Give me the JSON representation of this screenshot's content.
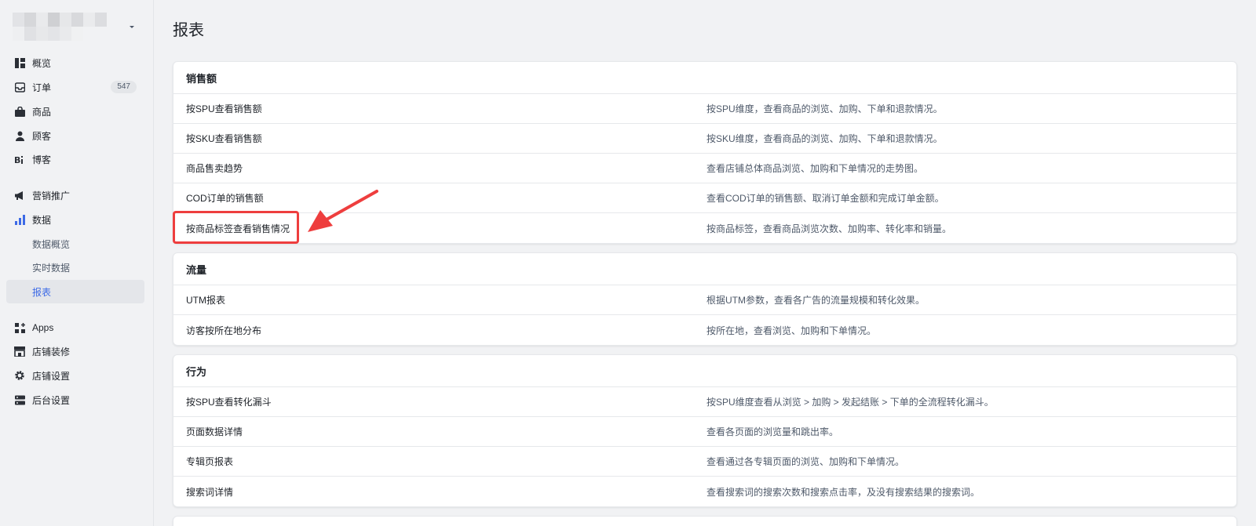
{
  "sidebar": {
    "nav": [
      {
        "label": "概览",
        "icon": "dashboard-icon"
      },
      {
        "label": "订单",
        "icon": "inbox-icon",
        "badge": "547"
      },
      {
        "label": "商品",
        "icon": "bag-icon"
      },
      {
        "label": "顾客",
        "icon": "person-icon"
      },
      {
        "label": "博客",
        "icon": "blog-icon"
      },
      {
        "label": "营销推广",
        "icon": "megaphone-icon"
      },
      {
        "label": "数据",
        "icon": "bar-chart-icon"
      }
    ],
    "data_sub": [
      "数据概览",
      "实时数据",
      "报表"
    ],
    "nav2": [
      {
        "label": "Apps",
        "icon": "apps-icon"
      },
      {
        "label": "店铺装修",
        "icon": "storefront-icon"
      },
      {
        "label": "店铺设置",
        "icon": "gear-icon"
      },
      {
        "label": "后台设置",
        "icon": "server-icon"
      }
    ]
  },
  "main": {
    "title": "报表",
    "sections": [
      {
        "title": "销售额",
        "rows": [
          {
            "name": "按SPU查看销售额",
            "desc": "按SPU维度，查看商品的浏览、加购、下单和退款情况。"
          },
          {
            "name": "按SKU查看销售额",
            "desc": "按SKU维度，查看商品的浏览、加购、下单和退款情况。"
          },
          {
            "name": "商品售卖趋势",
            "desc": "查看店铺总体商品浏览、加购和下单情况的走势图。"
          },
          {
            "name": "COD订单的销售额",
            "desc": "查看COD订单的销售额、取消订单金额和完成订单金额。"
          },
          {
            "name": "按商品标签查看销售情况",
            "desc": "按商品标签，查看商品浏览次数、加购率、转化率和销量。"
          }
        ]
      },
      {
        "title": "流量",
        "rows": [
          {
            "name": "UTM报表",
            "desc": "根据UTM参数，查看各广告的流量规模和转化效果。"
          },
          {
            "name": "访客按所在地分布",
            "desc": "按所在地，查看浏览、加购和下单情况。"
          }
        ]
      },
      {
        "title": "行为",
        "rows": [
          {
            "name": "按SPU查看转化漏斗",
            "desc": "按SPU维度查看从浏览 > 加购 > 发起结账 > 下单的全流程转化漏斗。"
          },
          {
            "name": "页面数据详情",
            "desc": "查看各页面的浏览量和跳出率。"
          },
          {
            "name": "专辑页报表",
            "desc": "查看通过各专辑页面的浏览、加购和下单情况。"
          },
          {
            "name": "搜索词详情",
            "desc": "查看搜索词的搜索次数和搜索点击率，及没有搜索结果的搜索词。"
          }
        ]
      }
    ]
  },
  "colors": {
    "accent": "#3d6ae6",
    "highlight": "#ee3e3e"
  }
}
